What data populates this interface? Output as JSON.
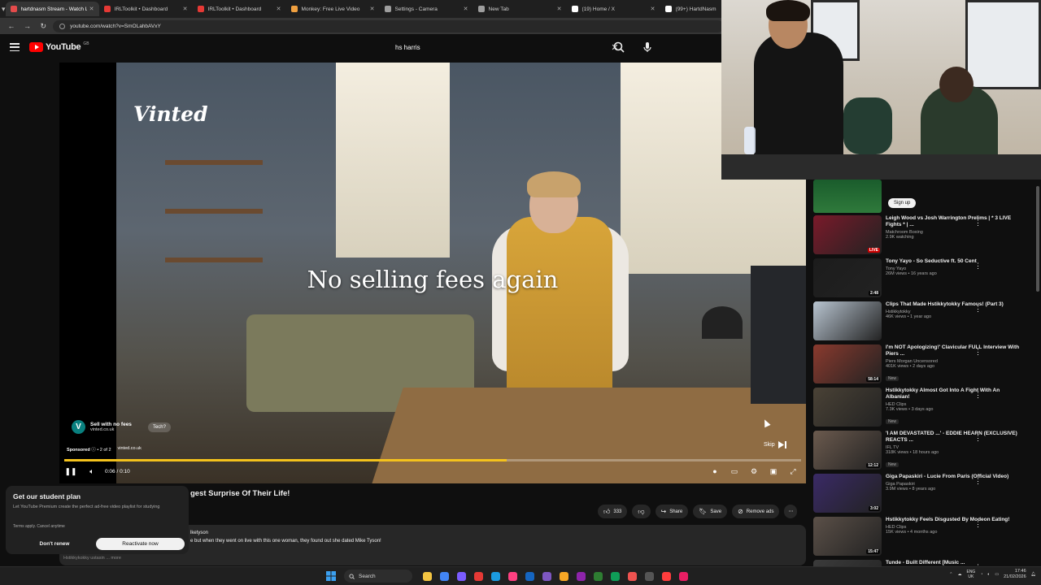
{
  "browser": {
    "tabs": [
      {
        "label": "hartdnasm Stream - Watch L",
        "color": "#e44b4b",
        "active": true
      },
      {
        "label": "IRLToolkit • Dashboard",
        "color": "#e53935",
        "active": false
      },
      {
        "label": "IRLToolkit • Dashboard",
        "color": "#e53935",
        "active": false
      },
      {
        "label": "Monkey: Free Live Video",
        "color": "#f0a040",
        "active": false
      },
      {
        "label": "Settings - Camera",
        "color": "#9e9e9e",
        "active": false
      },
      {
        "label": "New Tab",
        "color": "#9e9e9e",
        "active": false
      },
      {
        "label": "(19) Home / X",
        "color": "#ffffff",
        "active": false
      },
      {
        "label": "(99+) HartdNasm",
        "color": "#ffffff",
        "active": false
      }
    ],
    "url": "youtube.com/watch?v=SmOLahbAVxY"
  },
  "masthead": {
    "logo_text": "YouTube",
    "region": "GB",
    "search_value": "hs harris"
  },
  "ad": {
    "brand_logo": "Vinted",
    "caption": "No selling fees again",
    "card_title": "Sell with no fees",
    "card_url": "vinted.co.uk",
    "card_cta": "Tech?",
    "sponsored_label": "Sponsored",
    "sponsored_count": "• 2 of 2",
    "sponsored_url": "vinted.co.uk",
    "skip_label": "Skip",
    "time": "0:06 / 0:10",
    "progress": 0.6
  },
  "video": {
    "title": "gest Surprise Of Their Life!",
    "channel": "lketyson",
    "description": "e but when they went on live with this one woman, they found out she dated Mike Tyson!",
    "likes": "333",
    "share_label": "Share",
    "save_label": "Save",
    "remove_ads_label": "Remove ads"
  },
  "promo": {
    "title": "Get our student plan",
    "body": "Let YouTube Premium create the perfect ad-free video playlist for studying",
    "terms": "Terms apply. Cancel anytime",
    "dismiss_label": "Don't renew",
    "cta_label": "Reactivate now",
    "under_text": "Hstikkykokky ustasin ... more"
  },
  "sidebar": {
    "signup_label": "Sign up",
    "recommendations": [
      {
        "title": "Leigh Wood vs Josh Warrington Prelims | * 3 LIVE Fights * | ...",
        "channel": "Matchroom Boxing",
        "meta": "2.9K watching",
        "badge": "",
        "duration": "LIVE",
        "thumb": "#7a1a2a"
      },
      {
        "title": "Tony Yayo - So Seductive ft. 50 Cent",
        "channel": "Tony Yayo",
        "meta": "26M views • 16 years ago",
        "badge": "",
        "duration": "2:48",
        "thumb": "#1c1c1c"
      },
      {
        "title": "Clips That Made Hstikkytokky Famous! (Part 3)",
        "channel": "Hstikkytokky",
        "meta": "46K views • 1 year ago",
        "badge": "",
        "duration": "",
        "thumb": "#b8c4d0"
      },
      {
        "title": "I'm NOT Apologizing!' Clavicular FULL Interview With Piers ...",
        "channel": "Piers Morgan Uncensored",
        "meta": "401K views • 2 days ago",
        "badge": "New",
        "duration": "58:14",
        "thumb": "#8a3a2e"
      },
      {
        "title": "Hstikkytokky Almost Got Into A Fight With An Albanian!",
        "channel": "HED Clips",
        "meta": "7.3K views • 3 days ago",
        "badge": "New",
        "duration": "",
        "thumb": "#4a4236"
      },
      {
        "title": "'I AM DEVASTATED ...' - EDDIE HEARN (EXCLUSIVE) REACTS ...",
        "channel": "IFL TV",
        "meta": "318K views • 18 hours ago",
        "badge": "New",
        "duration": "12:12",
        "thumb": "#6b5a4e"
      },
      {
        "title": "Giga Papaskiri - Lucie From Paris (Official Video)",
        "channel": "Giga Papaskiri",
        "meta": "3.9M views • 8 years ago",
        "badge": "",
        "duration": "3:02",
        "thumb": "#3a2a66"
      },
      {
        "title": "Hstikkytokky Feels Disgusted By Modeon Eating!",
        "channel": "HED Clips",
        "meta": "15K views • 4 months ago",
        "badge": "",
        "duration": "15:47",
        "thumb": "#5b5048"
      },
      {
        "title": "Tunde - Built Different [Music ...",
        "channel": "",
        "meta": "",
        "badge": "",
        "duration": "",
        "thumb": "#3b3b3b"
      }
    ]
  },
  "taskbar": {
    "search_label": "Search",
    "lang_top": "ENG",
    "lang_bottom": "UK",
    "time": "17:46",
    "date": "21/02/2026",
    "apps": [
      "#f4c542",
      "#4285f4",
      "#7b5cff",
      "#e53935",
      "#1b9be0",
      "#ff4081",
      "#1565c0",
      "#7e57c2",
      "#f9a825",
      "#8e24aa",
      "#2e7d32",
      "#0f9d58",
      "#ef5350",
      "#555555",
      "#ff3d3d",
      "#e91e63"
    ]
  },
  "colors": {
    "accent": "#ff0000",
    "ad_progress": "#f4c21c"
  }
}
